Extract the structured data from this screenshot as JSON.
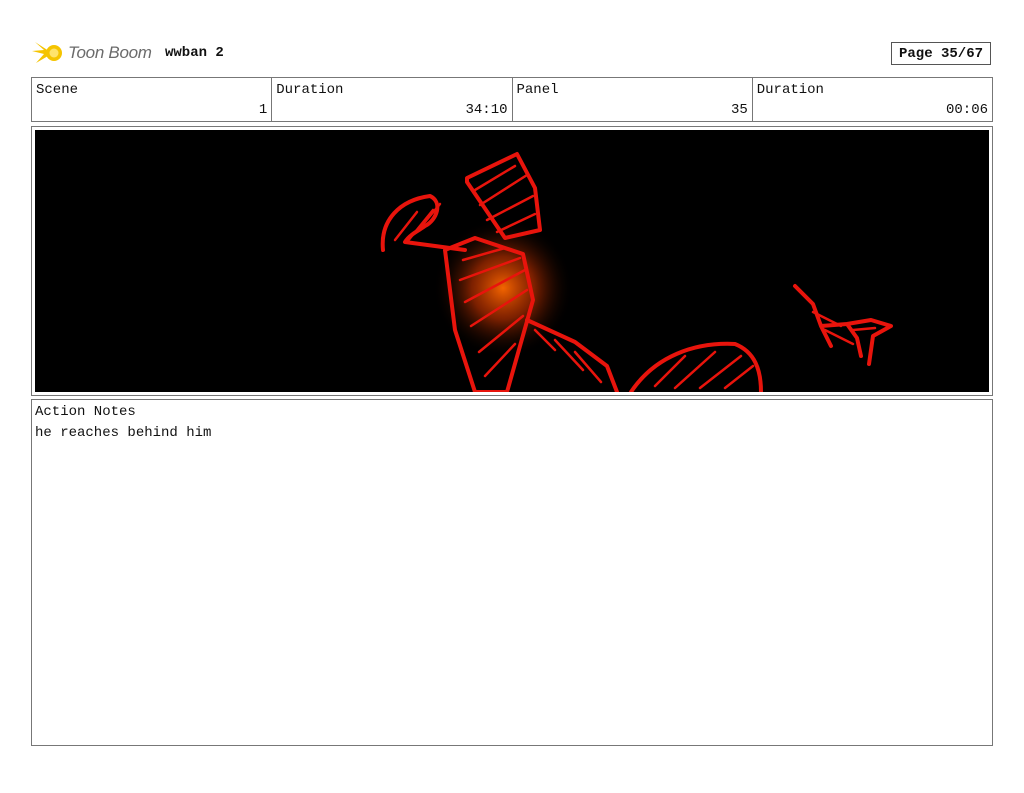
{
  "header": {
    "logo_text": "Toon Boom",
    "project_title": "wwban 2",
    "page_label": "Page 35/67"
  },
  "info": {
    "scene_label": "Scene",
    "scene_value": "1",
    "scene_duration_label": "Duration",
    "scene_duration_value": "34:10",
    "panel_label": "Panel",
    "panel_value": "35",
    "panel_duration_label": "Duration",
    "panel_duration_value": "00:06"
  },
  "notes": {
    "label": "Action Notes",
    "text": "he reaches behind him"
  },
  "colors": {
    "sketch_red": "#e8140c",
    "glow_orange": "#ff6a00",
    "logo_yellow": "#f5c400",
    "panel_background": "#000000"
  },
  "icons": {
    "logo": "toon-boom-star-icon"
  }
}
